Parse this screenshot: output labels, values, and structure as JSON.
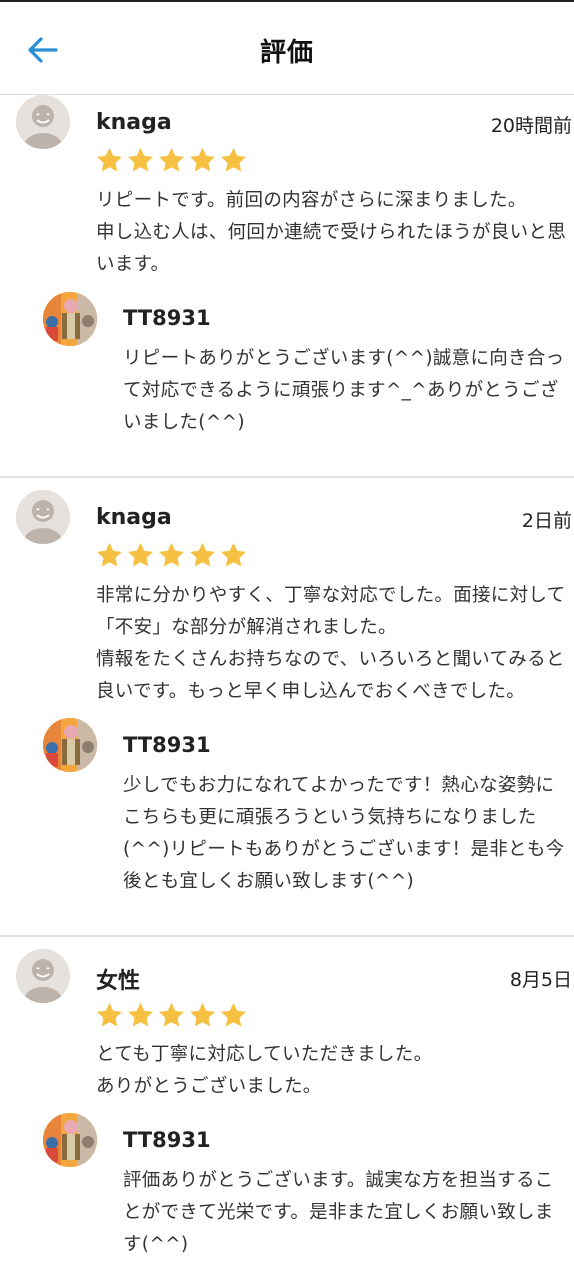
{
  "header": {
    "title": "評価",
    "back_icon": "back-arrow-icon",
    "accent_color": "#2a8fd8"
  },
  "star_color": "#f6c143",
  "reviews": [
    {
      "reviewer": "knaga",
      "date": "20時間前",
      "rating": 5,
      "text": "リピートです。前回の内容がさらに深まりました。\n申し込む人は、何回か連続で受けられたほうが良いと思います。",
      "reply": {
        "name": "TT8931",
        "text": "リピートありがとうございます(^^)誠意に向き合って対応できるように頑張ります^_^ありがとうございました(^^)"
      }
    },
    {
      "reviewer": "knaga",
      "date": "2日前",
      "rating": 5,
      "text": "非常に分かりやすく、丁寧な対応でした。面接に対して「不安」な部分が解消されました。\n情報をたくさんお持ちなので、いろいろと聞いてみると良いです。もっと早く申し込んでおくべきでした。",
      "reply": {
        "name": "TT8931",
        "text": "少しでもお力になれてよかったです！熱心な姿勢にこちらも更に頑張ろうという気持ちになりました(^^)リピートもありがとうございます！是非とも今後とも宜しくお願い致します(^^)"
      }
    },
    {
      "reviewer": "女性",
      "date": "8月5日",
      "rating": 5,
      "text": "とても丁寧に対応していただきました。\nありがとうございました。",
      "reply": {
        "name": "TT8931",
        "text": "評価ありがとうございます。誠実な方を担当することができて光栄です。是非また宜しくお願い致します(^^)"
      }
    }
  ]
}
